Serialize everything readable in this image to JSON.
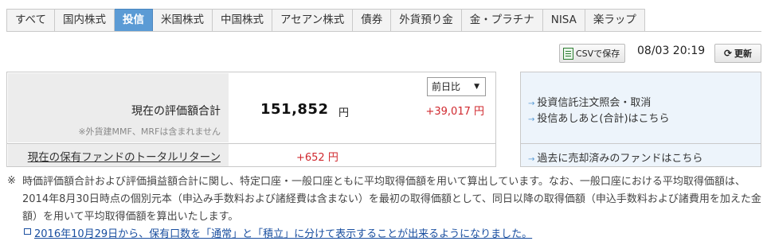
{
  "tabs": [
    {
      "label": "すべて",
      "active": false
    },
    {
      "label": "国内株式",
      "active": false
    },
    {
      "label": "投信",
      "active": true
    },
    {
      "label": "米国株式",
      "active": false
    },
    {
      "label": "中国株式",
      "active": false
    },
    {
      "label": "アセアン株式",
      "active": false
    },
    {
      "label": "債券",
      "active": false
    },
    {
      "label": "外貨預り金",
      "active": false
    },
    {
      "label": "金・プラチナ",
      "active": false
    },
    {
      "label": "NISA",
      "active": false
    },
    {
      "label": "楽ラップ",
      "active": false
    }
  ],
  "toolbar": {
    "csv_label": "CSVで保存",
    "csv_icon": "spreadsheet-icon",
    "timestamp": "08/03 20:19",
    "refresh_label": "更新",
    "refresh_icon": "refresh-icon"
  },
  "summary": {
    "label": "現在の評価額合計",
    "note": "※外貨建MMF、MRFは含まれません",
    "value": "151,852",
    "unit": "円",
    "compare_select": "前日比",
    "change": "+39,017 円",
    "return_label": "現在の保有ファンドのトータルリターン",
    "return_value": "+652 円"
  },
  "links": {
    "order_inquiry": "投資信託注文照会・取消",
    "history": "投信あしあと(合計)はこちら",
    "sold_funds": "過去に売却済みのファンドはこちら"
  },
  "notes": {
    "mark": "※",
    "text": "時価評価額合計および評価損益額合計に関し、特定口座・一般口座ともに平均取得価額を用いて算出しています。なお、一般口座における平均取得価額は、2014年8月30日時点の個別元本（申込み手数料および諸経費は含まない）を最初の取得価額として、同日以降の取得価額（申込手数料および諸費用を加えた金額）を用いて平均取得価額を算出いたします。",
    "link": "2016年10月29日から、保有口数を「通常」と「積立」に分けて表示することが出来るようになりました。"
  },
  "colors": {
    "active_tab": "#5b9bd5",
    "positive": "#d0282e",
    "link": "#1a4fa0"
  }
}
